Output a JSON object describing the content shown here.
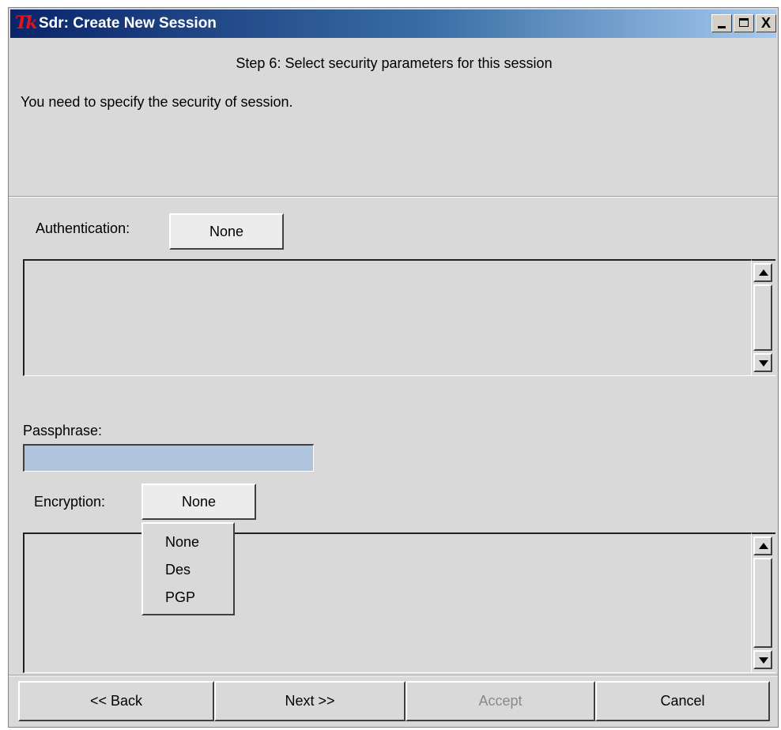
{
  "window": {
    "title": "Sdr: Create New Session",
    "logo_text": "Tk",
    "close_glyph": "X"
  },
  "step": {
    "heading": "Step 6: Select security parameters for this session",
    "description": "You need to specify the security of session."
  },
  "authentication": {
    "label": "Authentication:",
    "selected": "None",
    "list_content": ""
  },
  "passphrase": {
    "label": "Passphrase:",
    "value": ""
  },
  "encryption": {
    "label": "Encryption:",
    "selected": "None",
    "options": [
      "None",
      "Des",
      "PGP"
    ]
  },
  "buttons": {
    "back": "<< Back",
    "next": "Next >>",
    "accept": "Accept",
    "cancel": "Cancel"
  },
  "icons": {
    "minimize": "minimize-icon",
    "maximize": "maximize-icon",
    "close": "close-icon",
    "scroll_up": "arrow-up-icon",
    "scroll_down": "arrow-down-icon"
  },
  "colors": {
    "title_gradient_start": "#0a246a",
    "title_gradient_end": "#a6caf0",
    "window_bg": "#d9d9d9",
    "entry_bg": "#b0c4de",
    "disabled_text": "#8a8a8a"
  }
}
